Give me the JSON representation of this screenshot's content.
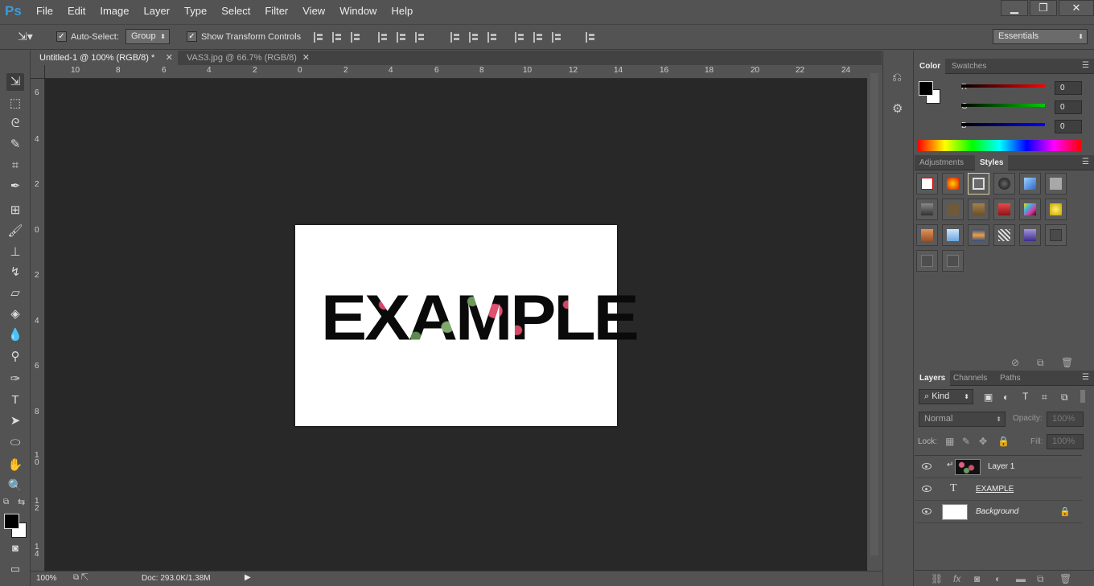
{
  "app": {
    "logo": "Ps"
  },
  "menu": [
    "File",
    "Edit",
    "Image",
    "Layer",
    "Type",
    "Select",
    "Filter",
    "View",
    "Window",
    "Help"
  ],
  "window_controls": {
    "minimize": "▁",
    "restore": "❐",
    "close": "✕"
  },
  "options": {
    "auto_select_label": "Auto-Select:",
    "auto_select_checked": true,
    "auto_select_target": "Group",
    "show_transform_label": "Show Transform Controls",
    "show_transform_checked": true,
    "workspace": "Essentials"
  },
  "tabs": [
    {
      "label": "Untitled-1 @ 100% (RGB/8) *",
      "close": "✕",
      "active": true
    },
    {
      "label": "VAS3.jpg @ 66.7% (RGB/8)",
      "close": "✕",
      "active": false
    }
  ],
  "ruler": {
    "top": [
      "10",
      "8",
      "6",
      "4",
      "2",
      "0",
      "2",
      "4",
      "6",
      "8",
      "10",
      "12",
      "14",
      "16",
      "18",
      "20",
      "22",
      "24"
    ],
    "left": [
      "6",
      "4",
      "2",
      "0",
      "2",
      "4",
      "6",
      "8",
      "1\n0",
      "1\n2",
      "1\n4"
    ]
  },
  "document": {
    "text": "EXAMPLE"
  },
  "status": {
    "zoom": "100%",
    "doc_info": "Doc: 293.0K/1.38M"
  },
  "color_panel": {
    "tabs": [
      "Color",
      "Swatches"
    ],
    "r_label": "R",
    "r_value": "0",
    "g_label": "G",
    "g_value": "0",
    "b_label": "B",
    "b_value": "0",
    "foreground": "#000000",
    "background": "#ffffff"
  },
  "adjust_panel": {
    "tabs": [
      "Adjustments",
      "Styles"
    ]
  },
  "styles": [
    "#ffffff",
    "#ff5a1f",
    "#6a6a6a",
    "#2b2b2b",
    "#3b7bd6",
    "#9a9a9a",
    "#5b5b5b",
    "#6f5a3b",
    "#8a6a3a",
    "#c8343a",
    "#6f8ad1",
    "#d6b600",
    "#c97445",
    "#88b7e8",
    "#c9873a",
    "#a0a0a0",
    "#7a67b5",
    "#4a4a4a",
    "#4e4e4e",
    "#4e4e4e"
  ],
  "layers_panel": {
    "tabs": [
      "Layers",
      "Channels",
      "Paths"
    ],
    "kind_label": "Kind",
    "blend_mode": "Normal",
    "opacity_label": "Opacity:",
    "opacity_value": "100%",
    "lock_label": "Lock:",
    "fill_label": "Fill:",
    "fill_value": "100%",
    "layers": [
      {
        "name": "Layer 1",
        "kind": "pixel-clipped"
      },
      {
        "name": "EXAMPLE",
        "kind": "text"
      },
      {
        "name": "Background",
        "kind": "background",
        "locked": true
      }
    ]
  }
}
